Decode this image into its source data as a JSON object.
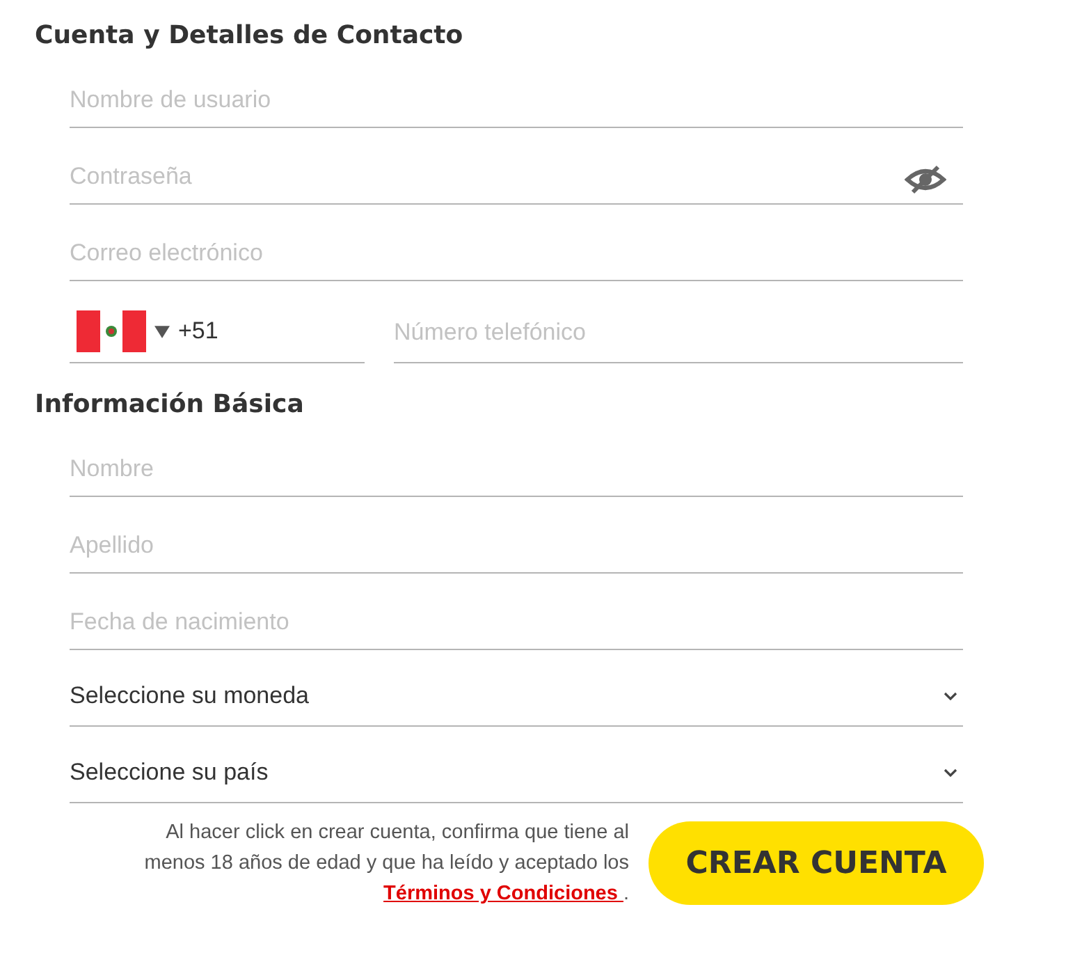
{
  "sections": [
    {
      "title": "Cuenta y Detalles de Contacto",
      "fields": [
        {
          "kind": "text",
          "placeholder": "Nombre de usuario"
        },
        {
          "kind": "password",
          "placeholder": "Contraseña"
        },
        {
          "kind": "text",
          "placeholder": "Correo electrónico"
        },
        {
          "kind": "phone",
          "code": "+51",
          "placeholder": "Número telefónico"
        }
      ]
    },
    {
      "title": "Información Básica",
      "fields": [
        {
          "kind": "text",
          "placeholder": "Nombre"
        },
        {
          "kind": "text",
          "placeholder": "Apellido"
        },
        {
          "kind": "text",
          "placeholder": "Fecha de nacimiento"
        },
        {
          "kind": "select",
          "value": "Seleccione su moneda"
        },
        {
          "kind": "select",
          "value": "Seleccione su país"
        }
      ]
    }
  ],
  "terms": {
    "text": "Al hacer click en crear cuenta, confirma que tiene al menos 18 años de edad y que ha leído y aceptado los",
    "link": "Términos y Condiciones ",
    "end": "."
  },
  "submit": "CREAR CUENTA"
}
